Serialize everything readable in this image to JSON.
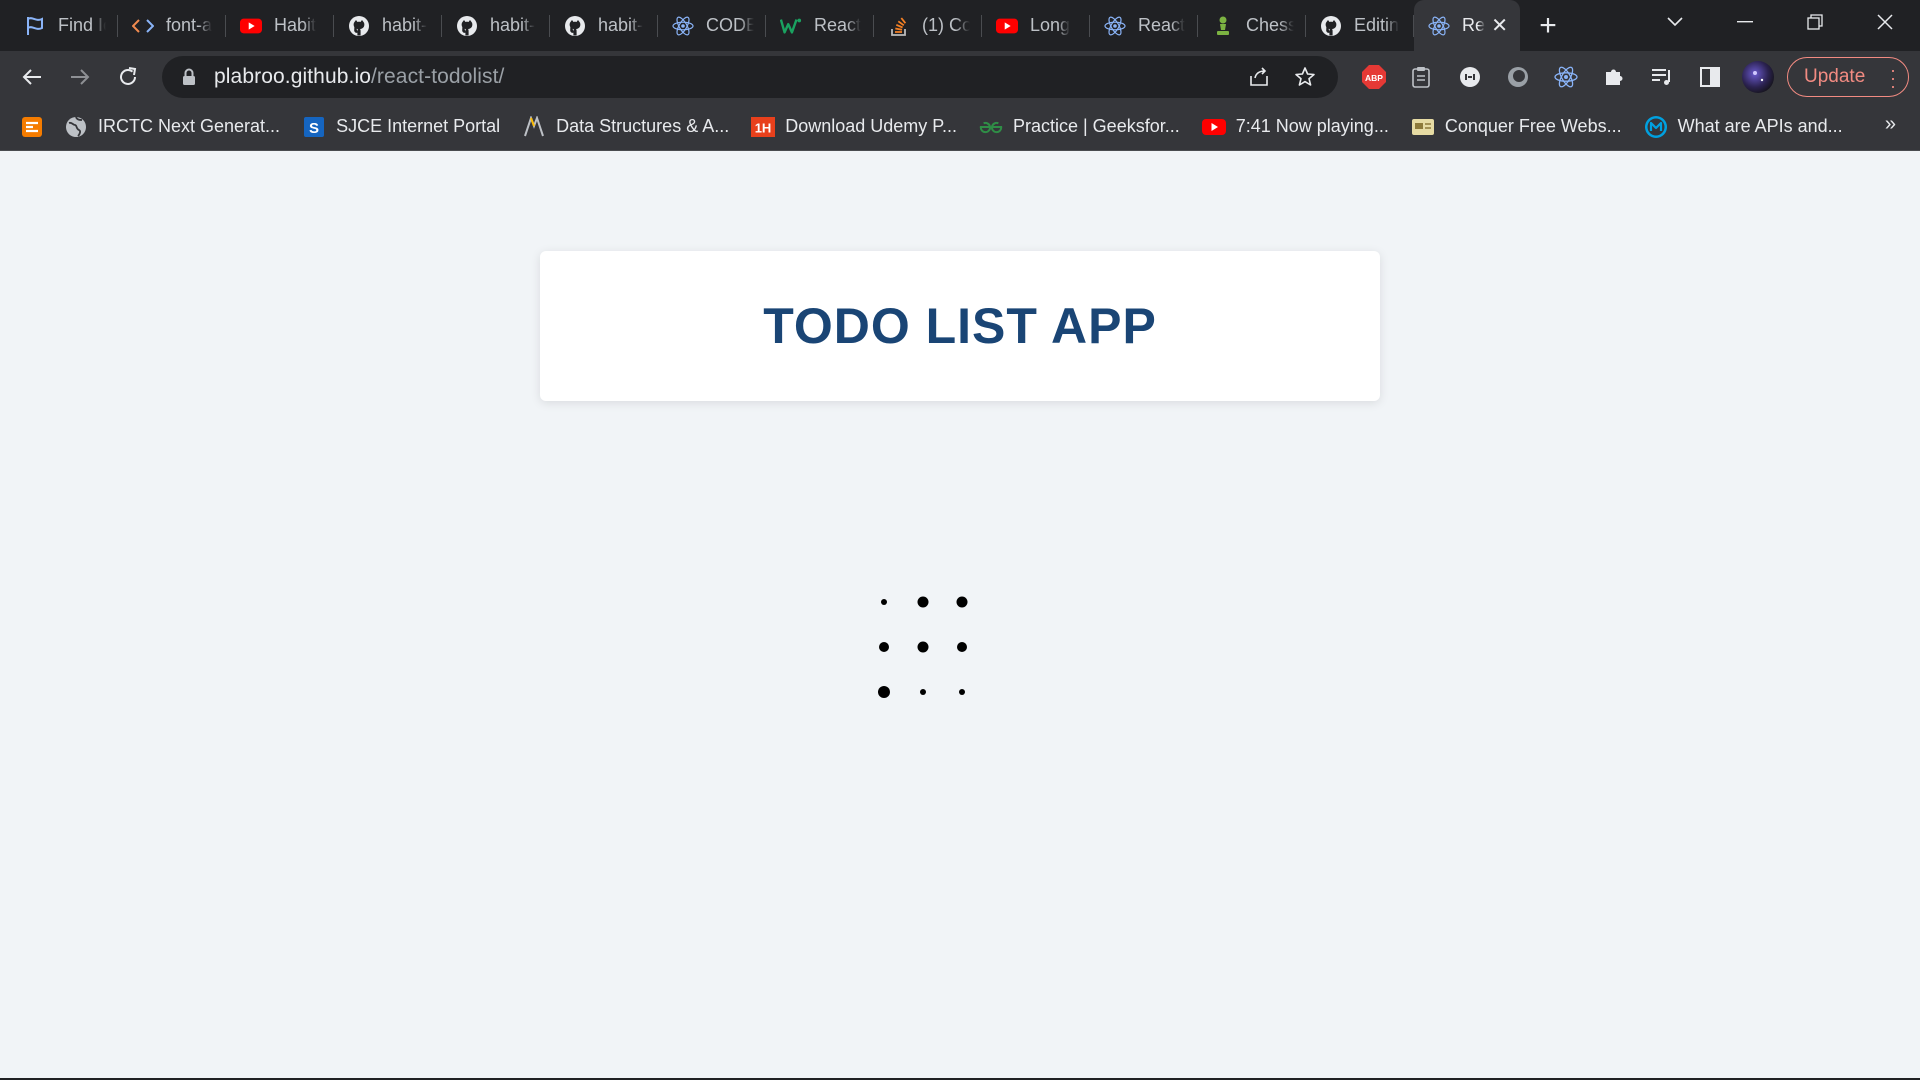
{
  "browser": {
    "tabs": [
      {
        "label": "Find Ic",
        "icon": "flag-icon"
      },
      {
        "label": "font-a",
        "icon": "code-brackets-icon"
      },
      {
        "label": "Habit",
        "icon": "youtube-icon"
      },
      {
        "label": "habit-",
        "icon": "github-icon"
      },
      {
        "label": "habit-",
        "icon": "github-icon"
      },
      {
        "label": "habit-",
        "icon": "github-icon"
      },
      {
        "label": "CODE",
        "icon": "react-icon"
      },
      {
        "label": "React",
        "icon": "w-logo-icon"
      },
      {
        "label": "(1) Co",
        "icon": "stackoverflow-icon"
      },
      {
        "label": "Long",
        "icon": "youtube-icon"
      },
      {
        "label": "React",
        "icon": "react-icon"
      },
      {
        "label": "Chess",
        "icon": "chess-pawn-icon"
      },
      {
        "label": "Editin",
        "icon": "github-icon"
      }
    ],
    "active_tab": {
      "label": "Re",
      "icon": "react-icon"
    },
    "address": {
      "host": "plabroo.github.io",
      "path": "/react-todolist/"
    },
    "update_label": "Update",
    "extensions": [
      "adblock-icon",
      "clipboard-icon",
      "extension-circle-icon",
      "extension-ring-icon",
      "react-devtools-icon",
      "puzzle-icon",
      "media-playlist-icon",
      "side-panel-icon",
      "profile-avatar-icon"
    ],
    "bookmarks": [
      {
        "label": "",
        "icon": "orange-app-icon"
      },
      {
        "label": "IRCTC Next Generat...",
        "icon": "globe-icon"
      },
      {
        "label": "SJCE Internet Portal",
        "icon": "s-logo-icon"
      },
      {
        "label": "Data Structures & A...",
        "icon": "ds-logo-icon"
      },
      {
        "label": "Download Udemy P...",
        "icon": "1h-logo-icon"
      },
      {
        "label": "Practice | Geeksfor...",
        "icon": "gfg-icon"
      },
      {
        "label": "7:41 Now playing...",
        "icon": "youtube-icon"
      },
      {
        "label": "Conquer Free Webs...",
        "icon": "card-icon"
      },
      {
        "label": "What are APIs and...",
        "icon": "mulesoft-icon"
      }
    ],
    "bookmarks_more": "»",
    "colors": {
      "frame": "#202124",
      "toolbar": "#35363a",
      "update": "#f28b82"
    }
  },
  "app": {
    "title": "TODO LIST APP",
    "title_color": "#1a4575",
    "background": "#f1f4f7",
    "loading": true
  }
}
